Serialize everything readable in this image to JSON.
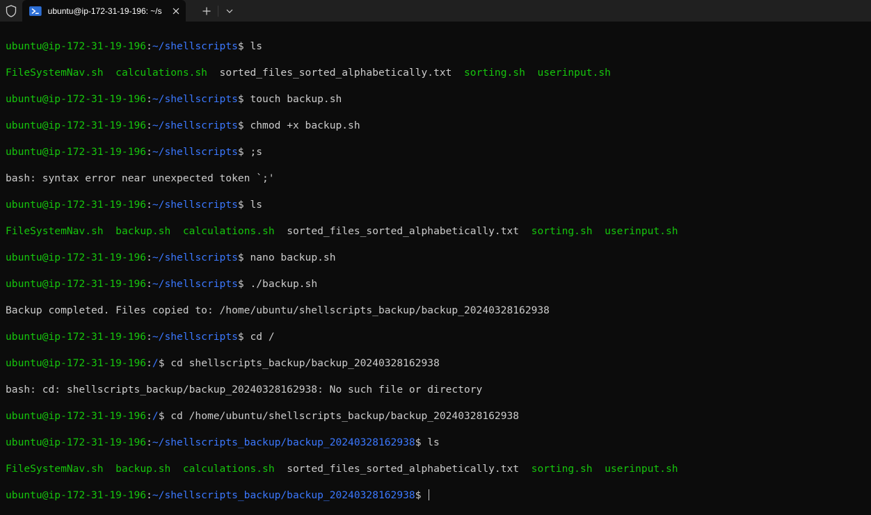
{
  "tab": {
    "title": "ubuntu@ip-172-31-19-196: ~/s",
    "icons": {
      "tab": "powershell-icon",
      "shield": "shield-icon",
      "close": "close-icon",
      "new": "plus-icon",
      "dropdown": "chevron-down-icon"
    }
  },
  "colors": {
    "user": "#16c60c",
    "path": "#3b78ff",
    "text": "#cccccc",
    "exec": "#16c60c",
    "bg": "#0c0c0c"
  },
  "terminal": {
    "l1": {
      "user": "ubuntu@ip-172-31-19-196",
      "colon": ":",
      "path": "~/shellscripts",
      "cmd": "$ ls"
    },
    "l2": {
      "f1": "FileSystemNav.sh",
      "s1": "  ",
      "f2": "calculations.sh",
      "s2": "  ",
      "f3": "sorted_files_sorted_alphabetically.txt",
      "s3": "  ",
      "f4": "sorting.sh",
      "s4": "  ",
      "f5": "userinput.sh"
    },
    "l3": {
      "user": "ubuntu@ip-172-31-19-196",
      "colon": ":",
      "path": "~/shellscripts",
      "cmd": "$ touch backup.sh"
    },
    "l4": {
      "user": "ubuntu@ip-172-31-19-196",
      "colon": ":",
      "path": "~/shellscripts",
      "cmd": "$ chmod +x backup.sh"
    },
    "l5": {
      "user": "ubuntu@ip-172-31-19-196",
      "colon": ":",
      "path": "~/shellscripts",
      "cmd": "$ ;s"
    },
    "l6": {
      "text": "bash: syntax error near unexpected token `;'"
    },
    "l7": {
      "user": "ubuntu@ip-172-31-19-196",
      "colon": ":",
      "path": "~/shellscripts",
      "cmd": "$ ls"
    },
    "l8": {
      "f1": "FileSystemNav.sh",
      "s1": "  ",
      "f2": "backup.sh",
      "s2": "  ",
      "f3": "calculations.sh",
      "s3": "  ",
      "f4": "sorted_files_sorted_alphabetically.txt",
      "s4": "  ",
      "f5": "sorting.sh",
      "s5": "  ",
      "f6": "userinput.sh"
    },
    "l9": {
      "user": "ubuntu@ip-172-31-19-196",
      "colon": ":",
      "path": "~/shellscripts",
      "cmd": "$ nano backup.sh"
    },
    "l10": {
      "user": "ubuntu@ip-172-31-19-196",
      "colon": ":",
      "path": "~/shellscripts",
      "cmd": "$ ./backup.sh"
    },
    "l11": {
      "text": "Backup completed. Files copied to: /home/ubuntu/shellscripts_backup/backup_20240328162938"
    },
    "l12": {
      "user": "ubuntu@ip-172-31-19-196",
      "colon": ":",
      "path": "~/shellscripts",
      "cmd": "$ cd /"
    },
    "l13": {
      "user": "ubuntu@ip-172-31-19-196",
      "colon": ":",
      "path": "/",
      "cmd": "$ cd shellscripts_backup/backup_20240328162938"
    },
    "l14": {
      "text": "bash: cd: shellscripts_backup/backup_20240328162938: No such file or directory"
    },
    "l15": {
      "user": "ubuntu@ip-172-31-19-196",
      "colon": ":",
      "path": "/",
      "cmd": "$ cd /home/ubuntu/shellscripts_backup/backup_20240328162938"
    },
    "l16": {
      "user": "ubuntu@ip-172-31-19-196",
      "colon": ":",
      "path": "~/shellscripts_backup/backup_20240328162938",
      "cmd": "$ ls"
    },
    "l17": {
      "f1": "FileSystemNav.sh",
      "s1": "  ",
      "f2": "backup.sh",
      "s2": "  ",
      "f3": "calculations.sh",
      "s3": "  ",
      "f4": "sorted_files_sorted_alphabetically.txt",
      "s4": "  ",
      "f5": "sorting.sh",
      "s5": "  ",
      "f6": "userinput.sh"
    },
    "l18": {
      "user": "ubuntu@ip-172-31-19-196",
      "colon": ":",
      "path": "~/shellscripts_backup/backup_20240328162938",
      "cmd": "$ "
    }
  }
}
